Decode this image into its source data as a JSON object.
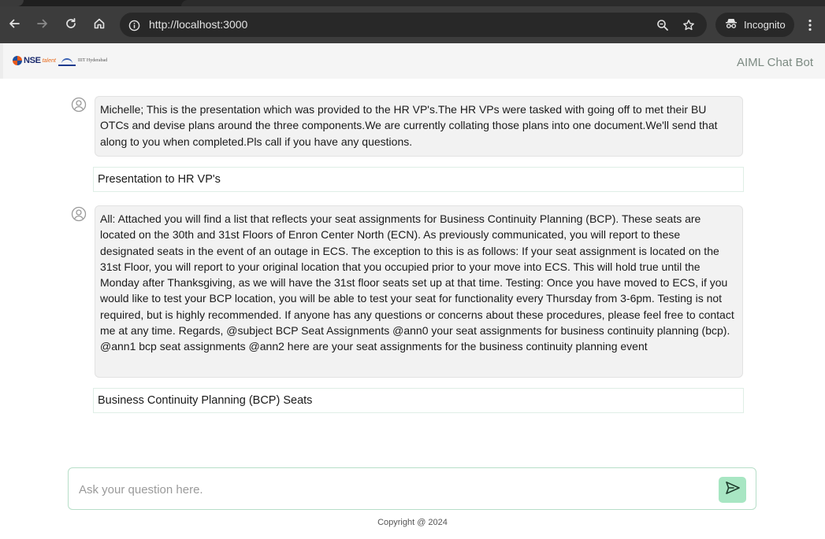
{
  "browser": {
    "url": "http://localhost:3000",
    "profile_label": "Incognito",
    "icons": [
      "back-icon",
      "forward-icon",
      "reload-icon",
      "home-icon",
      "info-icon",
      "zoom-icon",
      "star-icon",
      "incognito-icon",
      "menu-icon"
    ]
  },
  "header": {
    "logo_text": "NSE",
    "logo_subtext": "talent",
    "partner_text": "IIIT Hyderabad",
    "title": "AIML Chat Bot"
  },
  "conversation": [
    {
      "question": "Michelle; This is the presentation which was provided to the HR VP's.The HR VPs were tasked with going off to met their BU OTCs and devise plans around the three components.We are currently collating those plans into one document.We'll send that along to you when completed.Pls call if you have any questions.",
      "answer": "Presentation to HR VP's"
    },
    {
      "question": "All: Attached you will find a list that reflects your seat assignments for Business Continuity Planning (BCP). These seats are located on the 30th and 31st Floors of Enron Center North (ECN). As previously communicated, you will report to these designated seats in the event of an outage in ECS. The exception to this is as follows: If your seat assignment is located on the 31st Floor, you will report to your original location that you occupied prior to your move into ECS. This will hold true until the Monday after Thanksgiving, as we will have the 31st floor seats set up at that time. Testing: Once you have moved to ECS, if you would like to test your BCP location, you will be able to test your seat for functionality every Thursday from 3-6pm. Testing is not required, but is highly recommended. If anyone has any questions or concerns about these procedures, please feel free to contact me at any time. Regards, @subject BCP Seat Assignments @ann0 your seat assignments for business continuity planning (bcp). @ann1 bcp seat assignments @ann2 here are your seat assignments for the business continuity planning event",
      "answer": "Business Continuity Planning (BCP) Seats"
    }
  ],
  "input": {
    "placeholder": "Ask your question here.",
    "value": ""
  },
  "footer": {
    "text": "Copyright @ 2024"
  },
  "colors": {
    "send_button": "#a8e6c3",
    "input_border": "#b7dec8",
    "title_text": "#7c8a82",
    "bubble_bg": "#f2f2f2"
  }
}
